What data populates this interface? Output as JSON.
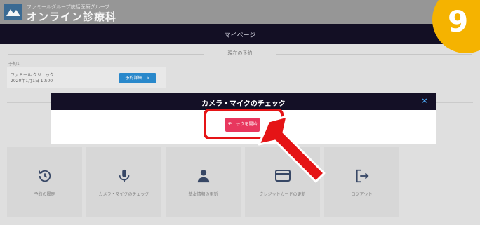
{
  "header": {
    "brand_sub": "ファミールグループ統括医療グループ",
    "brand_main": "オンライン診療科"
  },
  "navbar": {
    "title": "マイページ"
  },
  "reservations": {
    "section_title": "現在の予約",
    "label": "予約1",
    "name": "ファミール クリニック",
    "date": "2020年1月1日 10:00",
    "detail_button": "予約詳細　>"
  },
  "modal": {
    "title": "カメラ・マイクのチェック",
    "close": "×",
    "start_button": "チェックを開始"
  },
  "menu": {
    "tiles": [
      {
        "label": "予約の履歴",
        "icon": "history-icon"
      },
      {
        "label": "カメラ・マイクのチェック",
        "icon": "microphone-icon"
      },
      {
        "label": "基本情報の更新",
        "icon": "user-icon"
      },
      {
        "label": "クレジットカードの更新",
        "icon": "credit-card-icon"
      },
      {
        "label": "ログアウト",
        "icon": "logout-icon"
      }
    ]
  },
  "step_badge": "9",
  "colors": {
    "navbar": "#141026",
    "accent_button": "#e8375e",
    "highlight": "#e51416",
    "badge": "#f5b300",
    "detail_button": "#2b8ed4"
  }
}
